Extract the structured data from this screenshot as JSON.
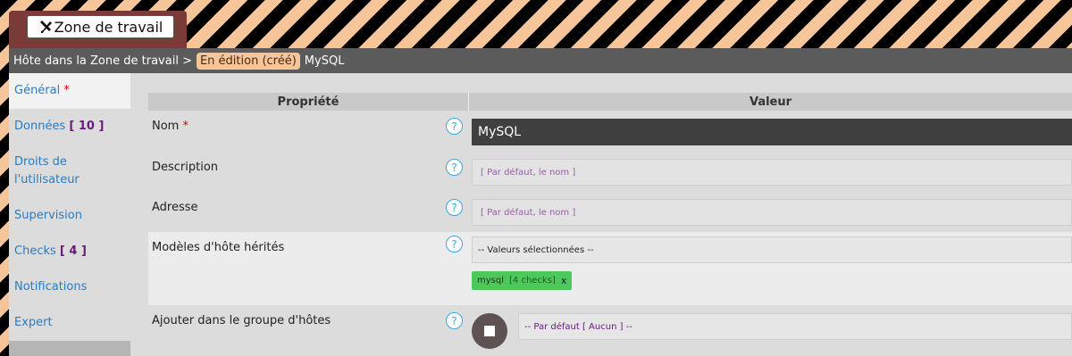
{
  "workspace": {
    "button_label": "Zone de travail",
    "icon": "tools-icon"
  },
  "breadcrumb": {
    "path": "Hôte dans la Zone de travail >",
    "status": "En édition (créé)",
    "current": "MySQL"
  },
  "sidebar": {
    "items": [
      {
        "label": "Général",
        "required": "*"
      },
      {
        "label": "Données",
        "count": "[ 10 ]"
      },
      {
        "label": "Droits de l'utilisateur"
      },
      {
        "label": "Supervision"
      },
      {
        "label": "Checks",
        "count": "[ 4 ]"
      },
      {
        "label": "Notifications"
      },
      {
        "label": "Expert"
      }
    ]
  },
  "table": {
    "headers": {
      "property": "Propriété",
      "value": "Valeur"
    },
    "help_glyph": "?",
    "rows": {
      "nom": {
        "label": "Nom",
        "required": "*",
        "value": "MySQL"
      },
      "description": {
        "label": "Description",
        "placeholder": "[ Par défaut, le nom ]"
      },
      "adresse": {
        "label": "Adresse",
        "placeholder": "[ Par défaut, le nom ]"
      },
      "modeles": {
        "label": "Modèles d'hôte hérités",
        "select_text": "-- Valeurs sélectionnées --",
        "tag": {
          "name": "mysql",
          "count": "[4 checks]",
          "remove": "x"
        }
      },
      "groupe": {
        "label": "Ajouter dans le groupe d'hôtes",
        "placeholder": "-- Par défaut [ Aucun ] --"
      }
    }
  },
  "colors": {
    "stripe_light": "#f6c69a",
    "stripe_dark": "#000000",
    "link_blue": "#2a7cc0",
    "tag_green": "#4cc95a",
    "count_purple": "#6a1a80"
  }
}
